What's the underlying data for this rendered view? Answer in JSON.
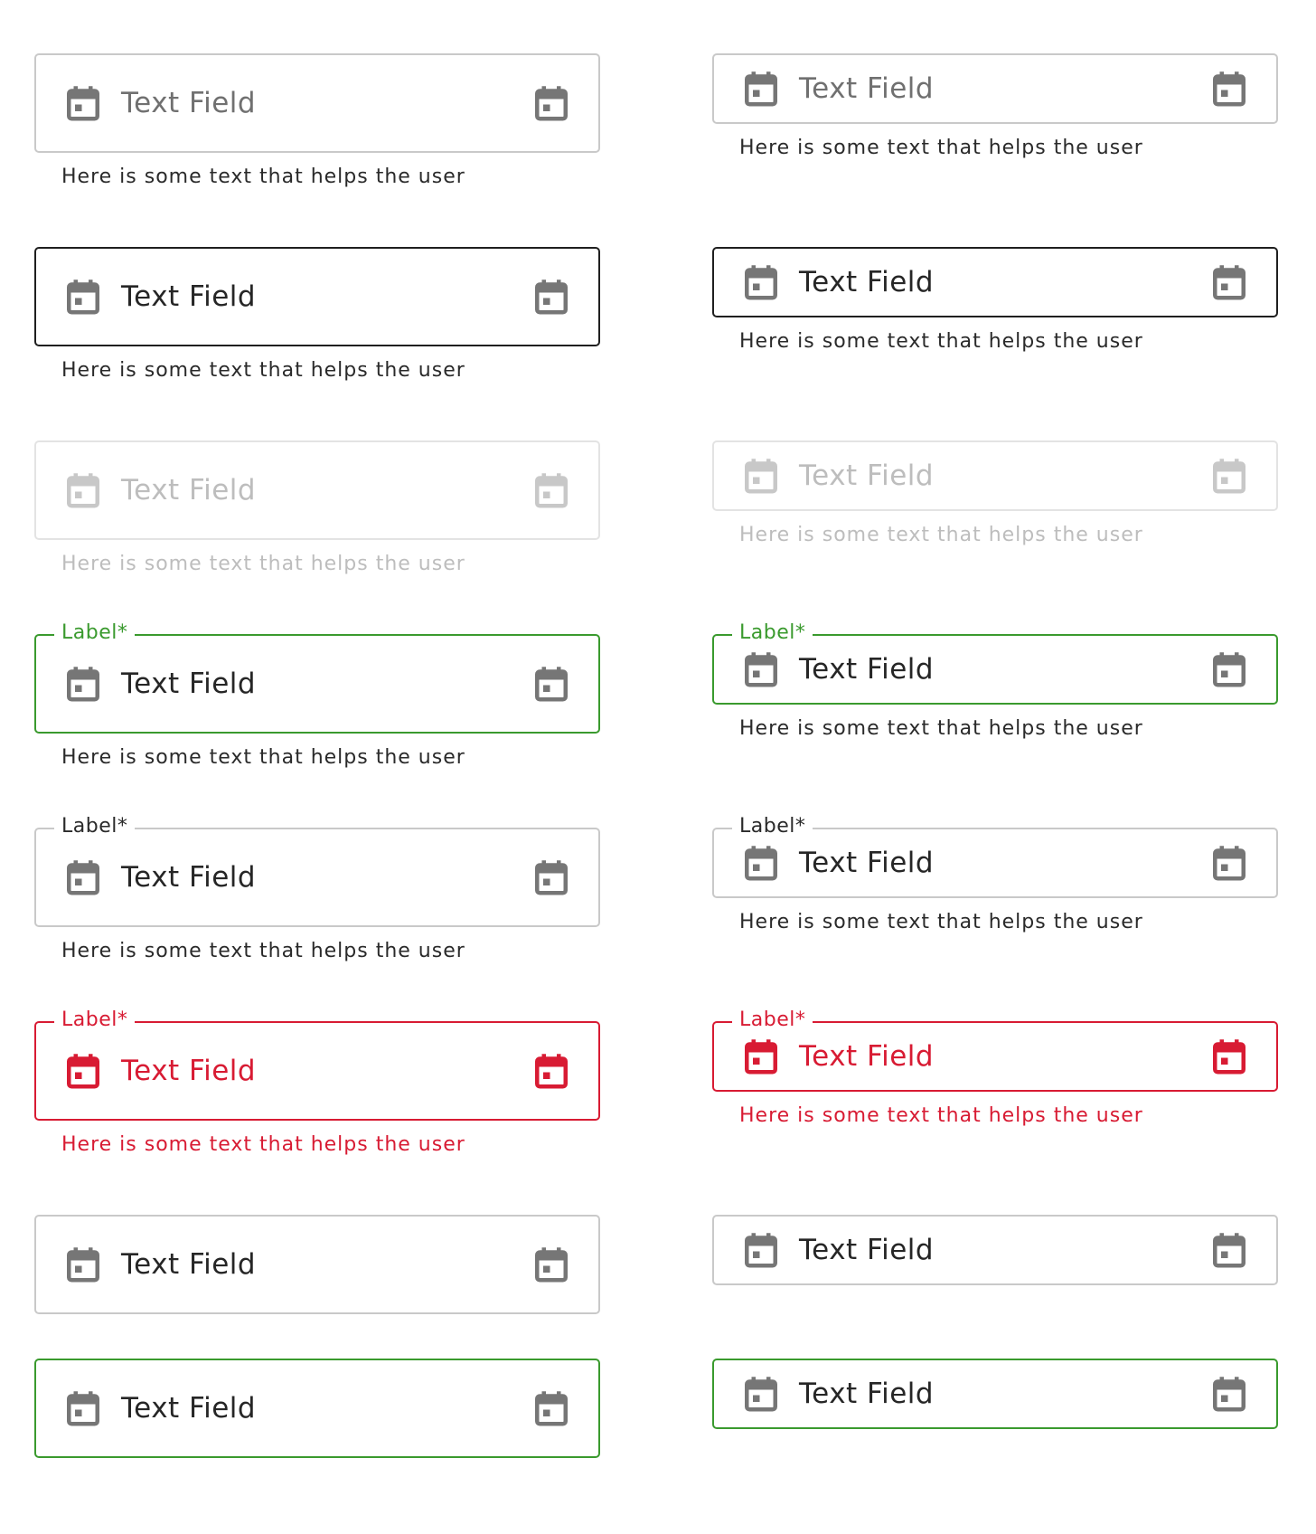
{
  "fields": [
    {
      "id": "r1c1",
      "state": "default",
      "value": "Text Field",
      "label": "",
      "helper": "Here is some text that helps the user"
    },
    {
      "id": "r1c2",
      "state": "default",
      "value": "Text Field",
      "label": "",
      "helper": "Here is some text that helps the user"
    },
    {
      "id": "r2c1",
      "state": "focus",
      "value": "Text Field",
      "label": "",
      "helper": "Here is some text that helps the user"
    },
    {
      "id": "r2c2",
      "state": "focus",
      "value": "Text Field",
      "label": "",
      "helper": "Here is some text that helps the user"
    },
    {
      "id": "r3c1",
      "state": "disabled",
      "value": "Text Field",
      "label": "",
      "helper": "Here is some text that helps the user"
    },
    {
      "id": "r3c2",
      "state": "disabled",
      "value": "Text Field",
      "label": "",
      "helper": "Here is some text that helps the user"
    },
    {
      "id": "r4c1",
      "state": "success",
      "value": "Text Field",
      "label": "Label*",
      "helper": "Here is some text that helps the user"
    },
    {
      "id": "r4c2",
      "state": "success",
      "value": "Text Field",
      "label": "Label*",
      "helper": "Here is some text that helps the user"
    },
    {
      "id": "r5c1",
      "state": "labeled",
      "value": "Text Field",
      "label": "Label*",
      "helper": "Here is some text that helps the user"
    },
    {
      "id": "r5c2",
      "state": "labeled",
      "value": "Text Field",
      "label": "Label*",
      "helper": "Here is some text that helps the user"
    },
    {
      "id": "r6c1",
      "state": "error",
      "value": "Text Field",
      "label": "Label*",
      "helper": "Here is some text that helps the user"
    },
    {
      "id": "r6c2",
      "state": "error",
      "value": "Text Field",
      "label": "Label*",
      "helper": "Here is some text that helps the user"
    },
    {
      "id": "r7c1",
      "state": "filled",
      "value": "Text Field",
      "label": "",
      "helper": ""
    },
    {
      "id": "r7c2",
      "state": "filled",
      "value": "Text Field",
      "label": "",
      "helper": ""
    },
    {
      "id": "r8c1",
      "state": "filled-success",
      "value": "Text Field",
      "label": "",
      "helper": ""
    },
    {
      "id": "r8c2",
      "state": "filled-success",
      "value": "Text Field",
      "label": "",
      "helper": ""
    }
  ],
  "icons": {
    "leading": "calendar-icon",
    "trailing": "calendar-icon"
  },
  "colors": {
    "border_default": "#c9c9c9",
    "border_focus": "#1f1f1f",
    "border_disabled": "#e3e3e3",
    "success": "#3a9a2e",
    "error": "#d81b33",
    "text_primary": "#262626",
    "text_placeholder": "#707070",
    "text_disabled": "#bdbdbd",
    "icon": "#767676"
  }
}
